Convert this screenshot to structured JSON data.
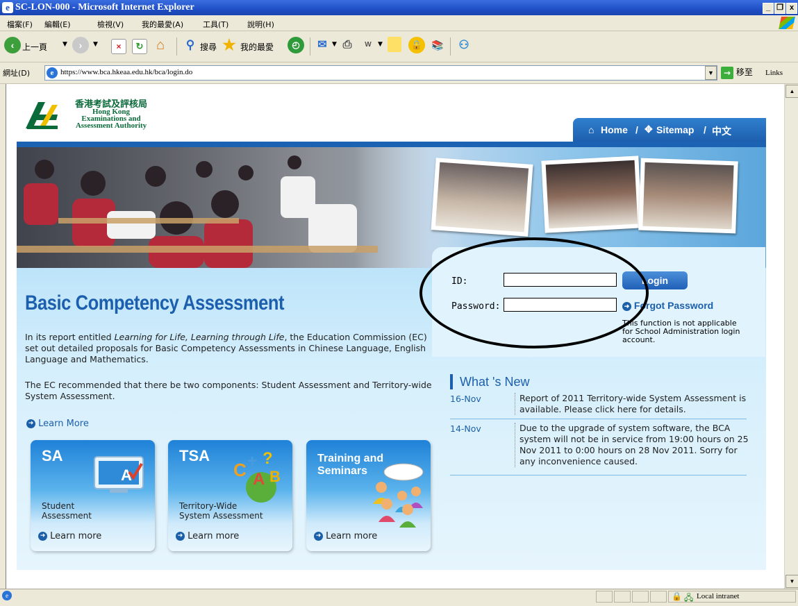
{
  "window": {
    "title": "SC-LON-000 - Microsoft Internet Explorer",
    "minimize": "_",
    "maximize": "ą",
    "close": "x"
  },
  "menu": [
    "檔案(F)",
    "編輯(E)",
    "檢視(V)",
    "我的最愛(A)",
    "工具(T)",
    "說明(H)"
  ],
  "toolbar": {
    "back_label": "上一頁",
    "search_label": "搜尋",
    "favorites_label": "我的最愛"
  },
  "address": {
    "label": "網址(D)",
    "url": "https://www.bca.hkeaa.edu.hk/bca/login.do",
    "go_label": "移至",
    "links_label": "Links"
  },
  "logo": {
    "chinese": "香港考試及評核局",
    "line1": "Hong Kong",
    "line2": "Examinations and",
    "line3": "Assessment Authority"
  },
  "nav": {
    "home": "Home",
    "sep1": "/",
    "sitemap": "Sitemap",
    "sep2": "/",
    "lang": "中文"
  },
  "login": {
    "id_label": "ID:",
    "id_value": "",
    "password_label": "Password:",
    "password_value": "",
    "login_button": "Login",
    "forgot_label": "Forgot Password",
    "note": "This function is not applicable for School Administration login account."
  },
  "main": {
    "title": "Basic Competency Assessment",
    "para1_pre": "In its report entitled ",
    "para1_em": "Learning for Life, Learning through Life",
    "para1_post": ", the Education Commission (EC) set out detailed proposals for Basic Competency Assessments in Chinese Language, English Language and Mathematics.",
    "para2": "The EC recommended that there be two components: Student Assessment and Territory-wide System Assessment.",
    "learn_more": "Learn More"
  },
  "cards": [
    {
      "title": "SA",
      "desc1": "Student",
      "desc2": "Assessment",
      "link": "Learn more"
    },
    {
      "title": "TSA",
      "desc1": "Territory-Wide",
      "desc2": "System Assessment",
      "link": "Learn more"
    },
    {
      "title1": "Training and",
      "title2": "Seminars",
      "link": "Learn more"
    }
  ],
  "news": {
    "heading": "What 's New",
    "items": [
      {
        "date": "16-Nov",
        "text": "Report of 2011 Territory-wide System Assessment is available. Please click here for details."
      },
      {
        "date": "14-Nov",
        "text": "Due to the upgrade of system software, the BCA system will not be in service from 19:00 hours on 25 Nov 2011 to 0:00 hours on 28 Nov 2011. Sorry for any inconvenience caused."
      }
    ]
  },
  "status": {
    "zone": "Local intranet"
  },
  "colors": {
    "brand_blue": "#1c5faa",
    "titlebar": "#1f4fc6",
    "panel_bg": "#d6effc"
  }
}
